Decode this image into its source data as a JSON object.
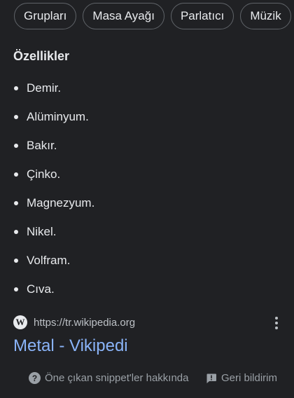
{
  "chips": [
    "Grupları",
    "Masa Ayağı",
    "Parlatıcı",
    "Müzik"
  ],
  "section": {
    "title": "Özellikler",
    "items": [
      "Demir.",
      "Alüminyum.",
      "Bakır.",
      "Çinko.",
      "Magnezyum.",
      "Nikel.",
      "Volfram.",
      "Cıva."
    ]
  },
  "result": {
    "favicon_letter": "W",
    "url": "https://tr.wikipedia.org",
    "title": "Metal - Vikipedi"
  },
  "footer": {
    "about_label": "Öne çıkan snippet'ler hakkında",
    "feedback_label": "Geri bildirim",
    "help_glyph": "?"
  },
  "icons": {
    "help": "help-circle-icon",
    "feedback": "feedback-icon",
    "more": "more-vert-icon",
    "favicon": "wikipedia-favicon-icon"
  },
  "colors": {
    "background": "#202124",
    "text": "#e8eaed",
    "link": "#8ab4f8",
    "muted": "#9aa0a6",
    "chip_border": "#5f6368"
  }
}
